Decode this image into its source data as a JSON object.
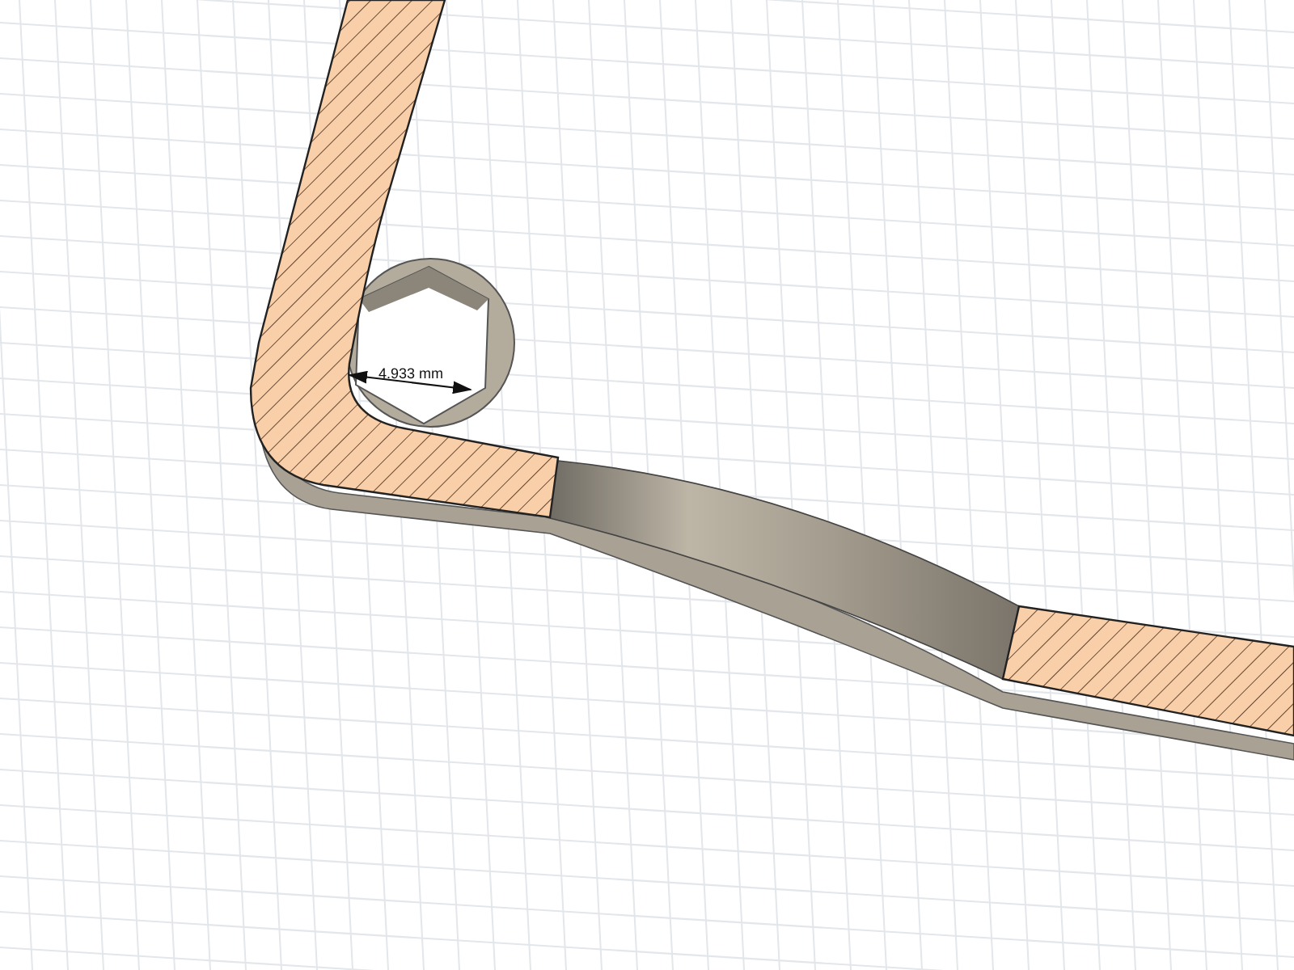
{
  "dimension": {
    "value": "4.933 mm"
  }
}
